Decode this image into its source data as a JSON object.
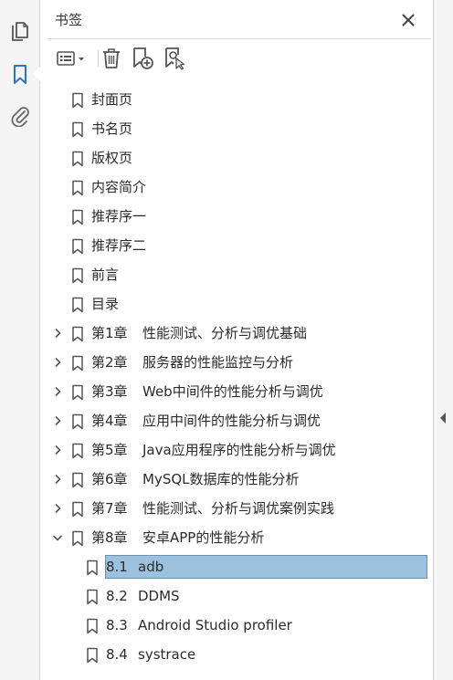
{
  "rail": {
    "items": [
      {
        "name": "pages-icon"
      },
      {
        "name": "bookmark-icon",
        "active": true
      },
      {
        "name": "attachment-icon"
      }
    ],
    "accent": "#2b74c7"
  },
  "panel": {
    "title": "书签",
    "close_icon": "close-icon",
    "toolbar": {
      "options_icon": "options-icon",
      "delete_icon": "trash-icon",
      "new_bookmark_icon": "add-bookmark-icon",
      "find_bookmark_icon": "find-bookmark-icon"
    }
  },
  "bookmarks": [
    {
      "num": "",
      "title": "封面页",
      "level": 0,
      "expandable": false
    },
    {
      "num": "",
      "title": "书名页",
      "level": 0,
      "expandable": false
    },
    {
      "num": "",
      "title": "版权页",
      "level": 0,
      "expandable": false
    },
    {
      "num": "",
      "title": "内容简介",
      "level": 0,
      "expandable": false
    },
    {
      "num": "",
      "title": "推荐序一",
      "level": 0,
      "expandable": false
    },
    {
      "num": "",
      "title": "推荐序二",
      "level": 0,
      "expandable": false
    },
    {
      "num": "",
      "title": "前言",
      "level": 0,
      "expandable": false
    },
    {
      "num": "",
      "title": "目录",
      "level": 0,
      "expandable": false
    },
    {
      "num": "第1章",
      "title": "性能测试、分析与调优基础",
      "level": 0,
      "expandable": true,
      "expanded": false
    },
    {
      "num": "第2章",
      "title": "服务器的性能监控与分析",
      "level": 0,
      "expandable": true,
      "expanded": false
    },
    {
      "num": "第3章",
      "title": "Web中间件的性能分析与调优",
      "level": 0,
      "expandable": true,
      "expanded": false
    },
    {
      "num": "第4章",
      "title": "应用中间件的性能分析与调优",
      "level": 0,
      "expandable": true,
      "expanded": false
    },
    {
      "num": "第5章",
      "title": "Java应用程序的性能分析与调优",
      "level": 0,
      "expandable": true,
      "expanded": false
    },
    {
      "num": "第6章",
      "title": "MySQL数据库的性能分析",
      "level": 0,
      "expandable": true,
      "expanded": false
    },
    {
      "num": "第7章",
      "title": "性能测试、分析与调优案例实践",
      "level": 0,
      "expandable": true,
      "expanded": false
    },
    {
      "num": "第8章",
      "title": "安卓APP的性能分析",
      "level": 0,
      "expandable": true,
      "expanded": true
    },
    {
      "num": "8.1",
      "title": "adb",
      "level": 1,
      "expandable": false,
      "selected": true
    },
    {
      "num": "8.2",
      "title": "DDMS",
      "level": 1,
      "expandable": false
    },
    {
      "num": "8.3",
      "title": "Android Studio profiler",
      "level": 1,
      "expandable": false
    },
    {
      "num": "8.4",
      "title": "systrace",
      "level": 1,
      "expandable": false
    }
  ],
  "colors": {
    "selection_fill": "#9bc1de",
    "selection_border": "#6d8fae"
  }
}
